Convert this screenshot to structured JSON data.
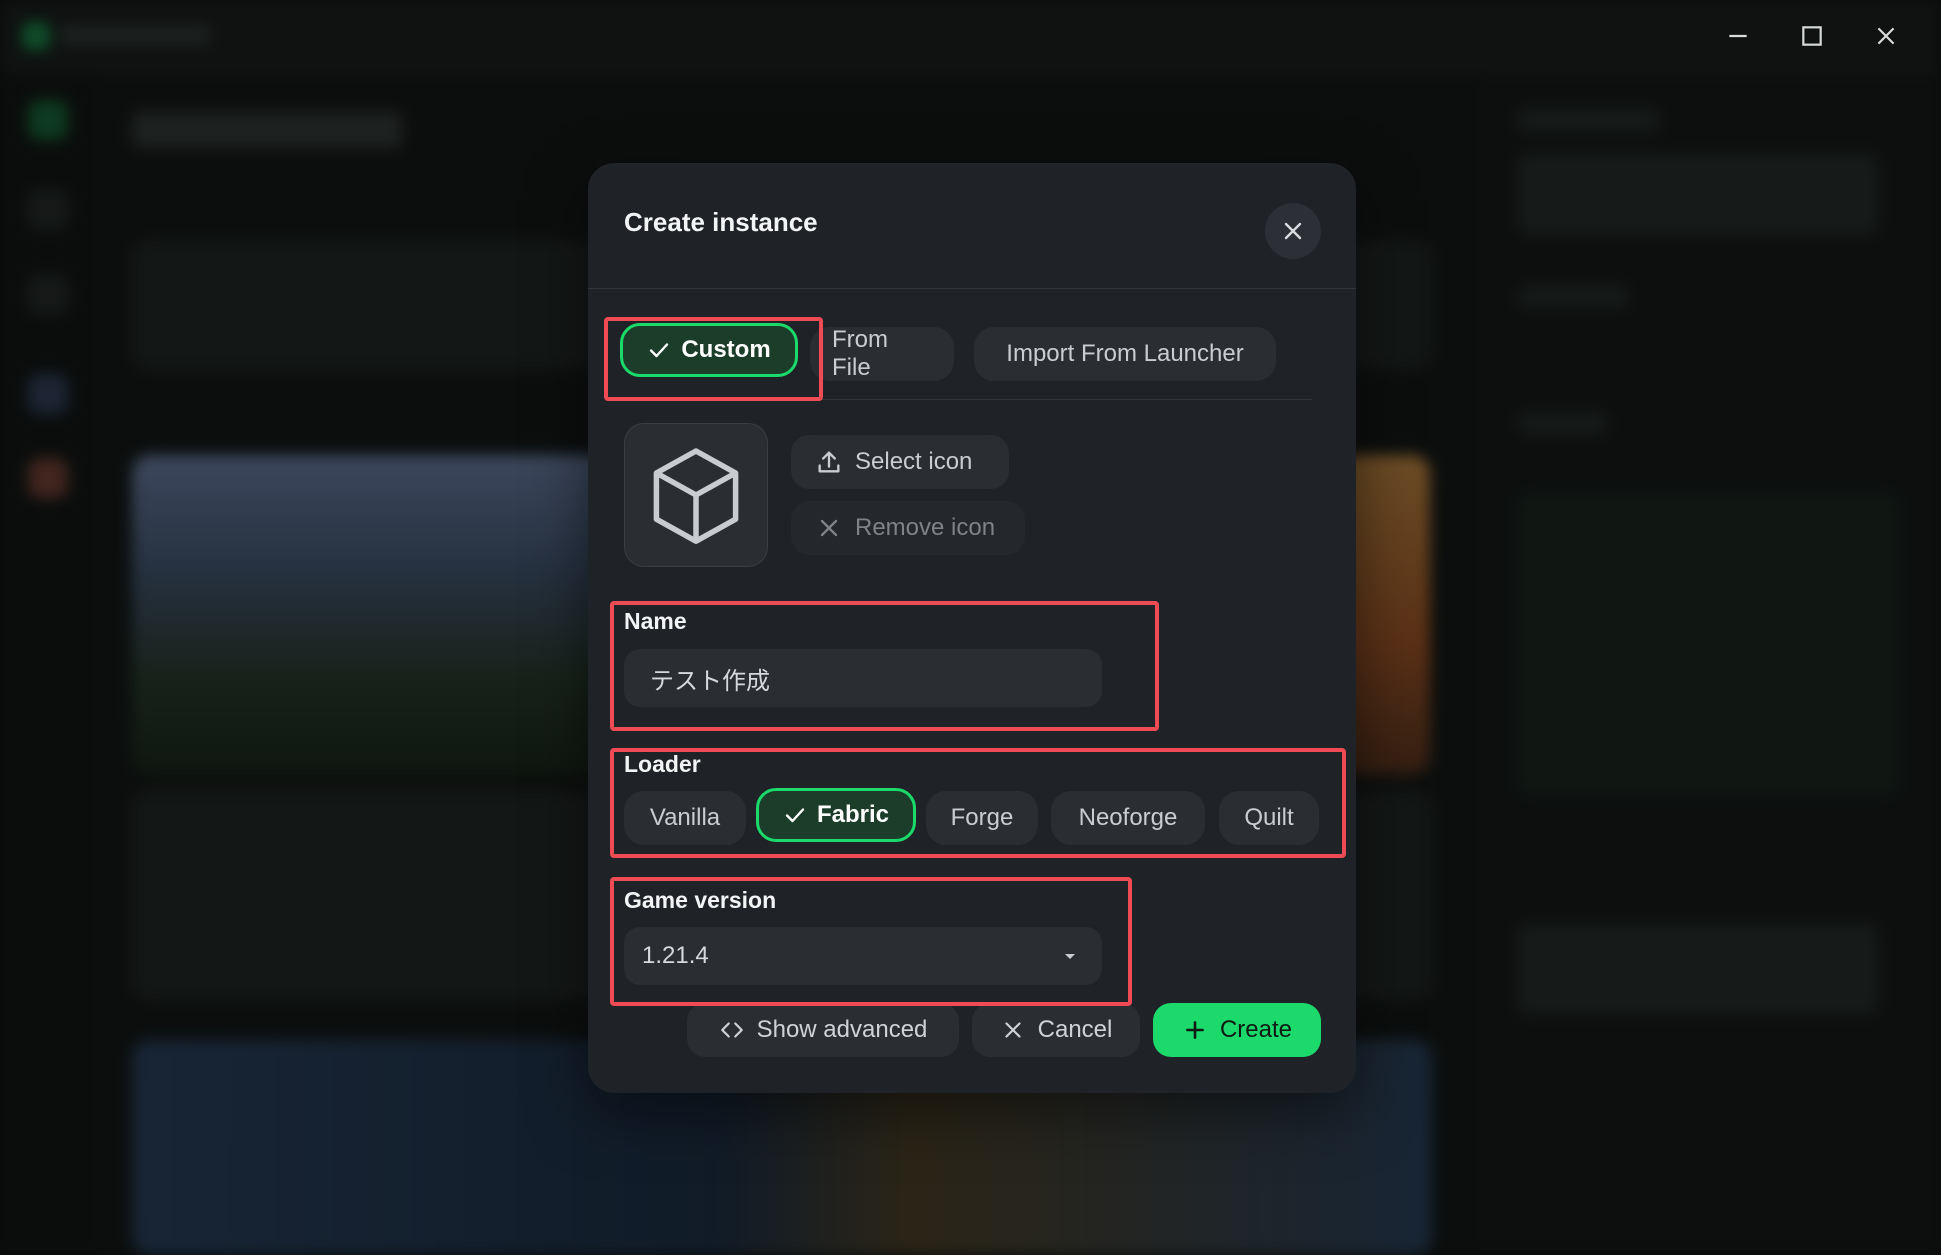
{
  "modal": {
    "title": "Create instance",
    "tabs": [
      {
        "label": "Custom",
        "selected": true
      },
      {
        "label": "From File",
        "selected": false
      },
      {
        "label": "Import From Launcher",
        "selected": false
      }
    ],
    "icon_actions": {
      "select_label": "Select icon",
      "remove_label": "Remove icon"
    },
    "name": {
      "label": "Name",
      "value": "テスト作成"
    },
    "loader": {
      "label": "Loader",
      "options": [
        {
          "label": "Vanilla",
          "selected": false
        },
        {
          "label": "Fabric",
          "selected": true
        },
        {
          "label": "Forge",
          "selected": false
        },
        {
          "label": "Neoforge",
          "selected": false
        },
        {
          "label": "Quilt",
          "selected": false
        }
      ]
    },
    "game_version": {
      "label": "Game version",
      "value": "1.21.4"
    },
    "footer": {
      "show_advanced_label": "Show advanced",
      "cancel_label": "Cancel",
      "create_label": "Create"
    }
  },
  "colors": {
    "accent": "#1bd96a",
    "modal_bg": "#1f2226",
    "button_bg": "#2a2e33",
    "annotation": "#ef4b55"
  },
  "icons": [
    "check-icon",
    "upload-icon",
    "x-icon",
    "cube-icon",
    "code-icon",
    "plus-icon",
    "chevron-down-icon",
    "minimize-icon",
    "maximize-icon",
    "close-icon"
  ]
}
